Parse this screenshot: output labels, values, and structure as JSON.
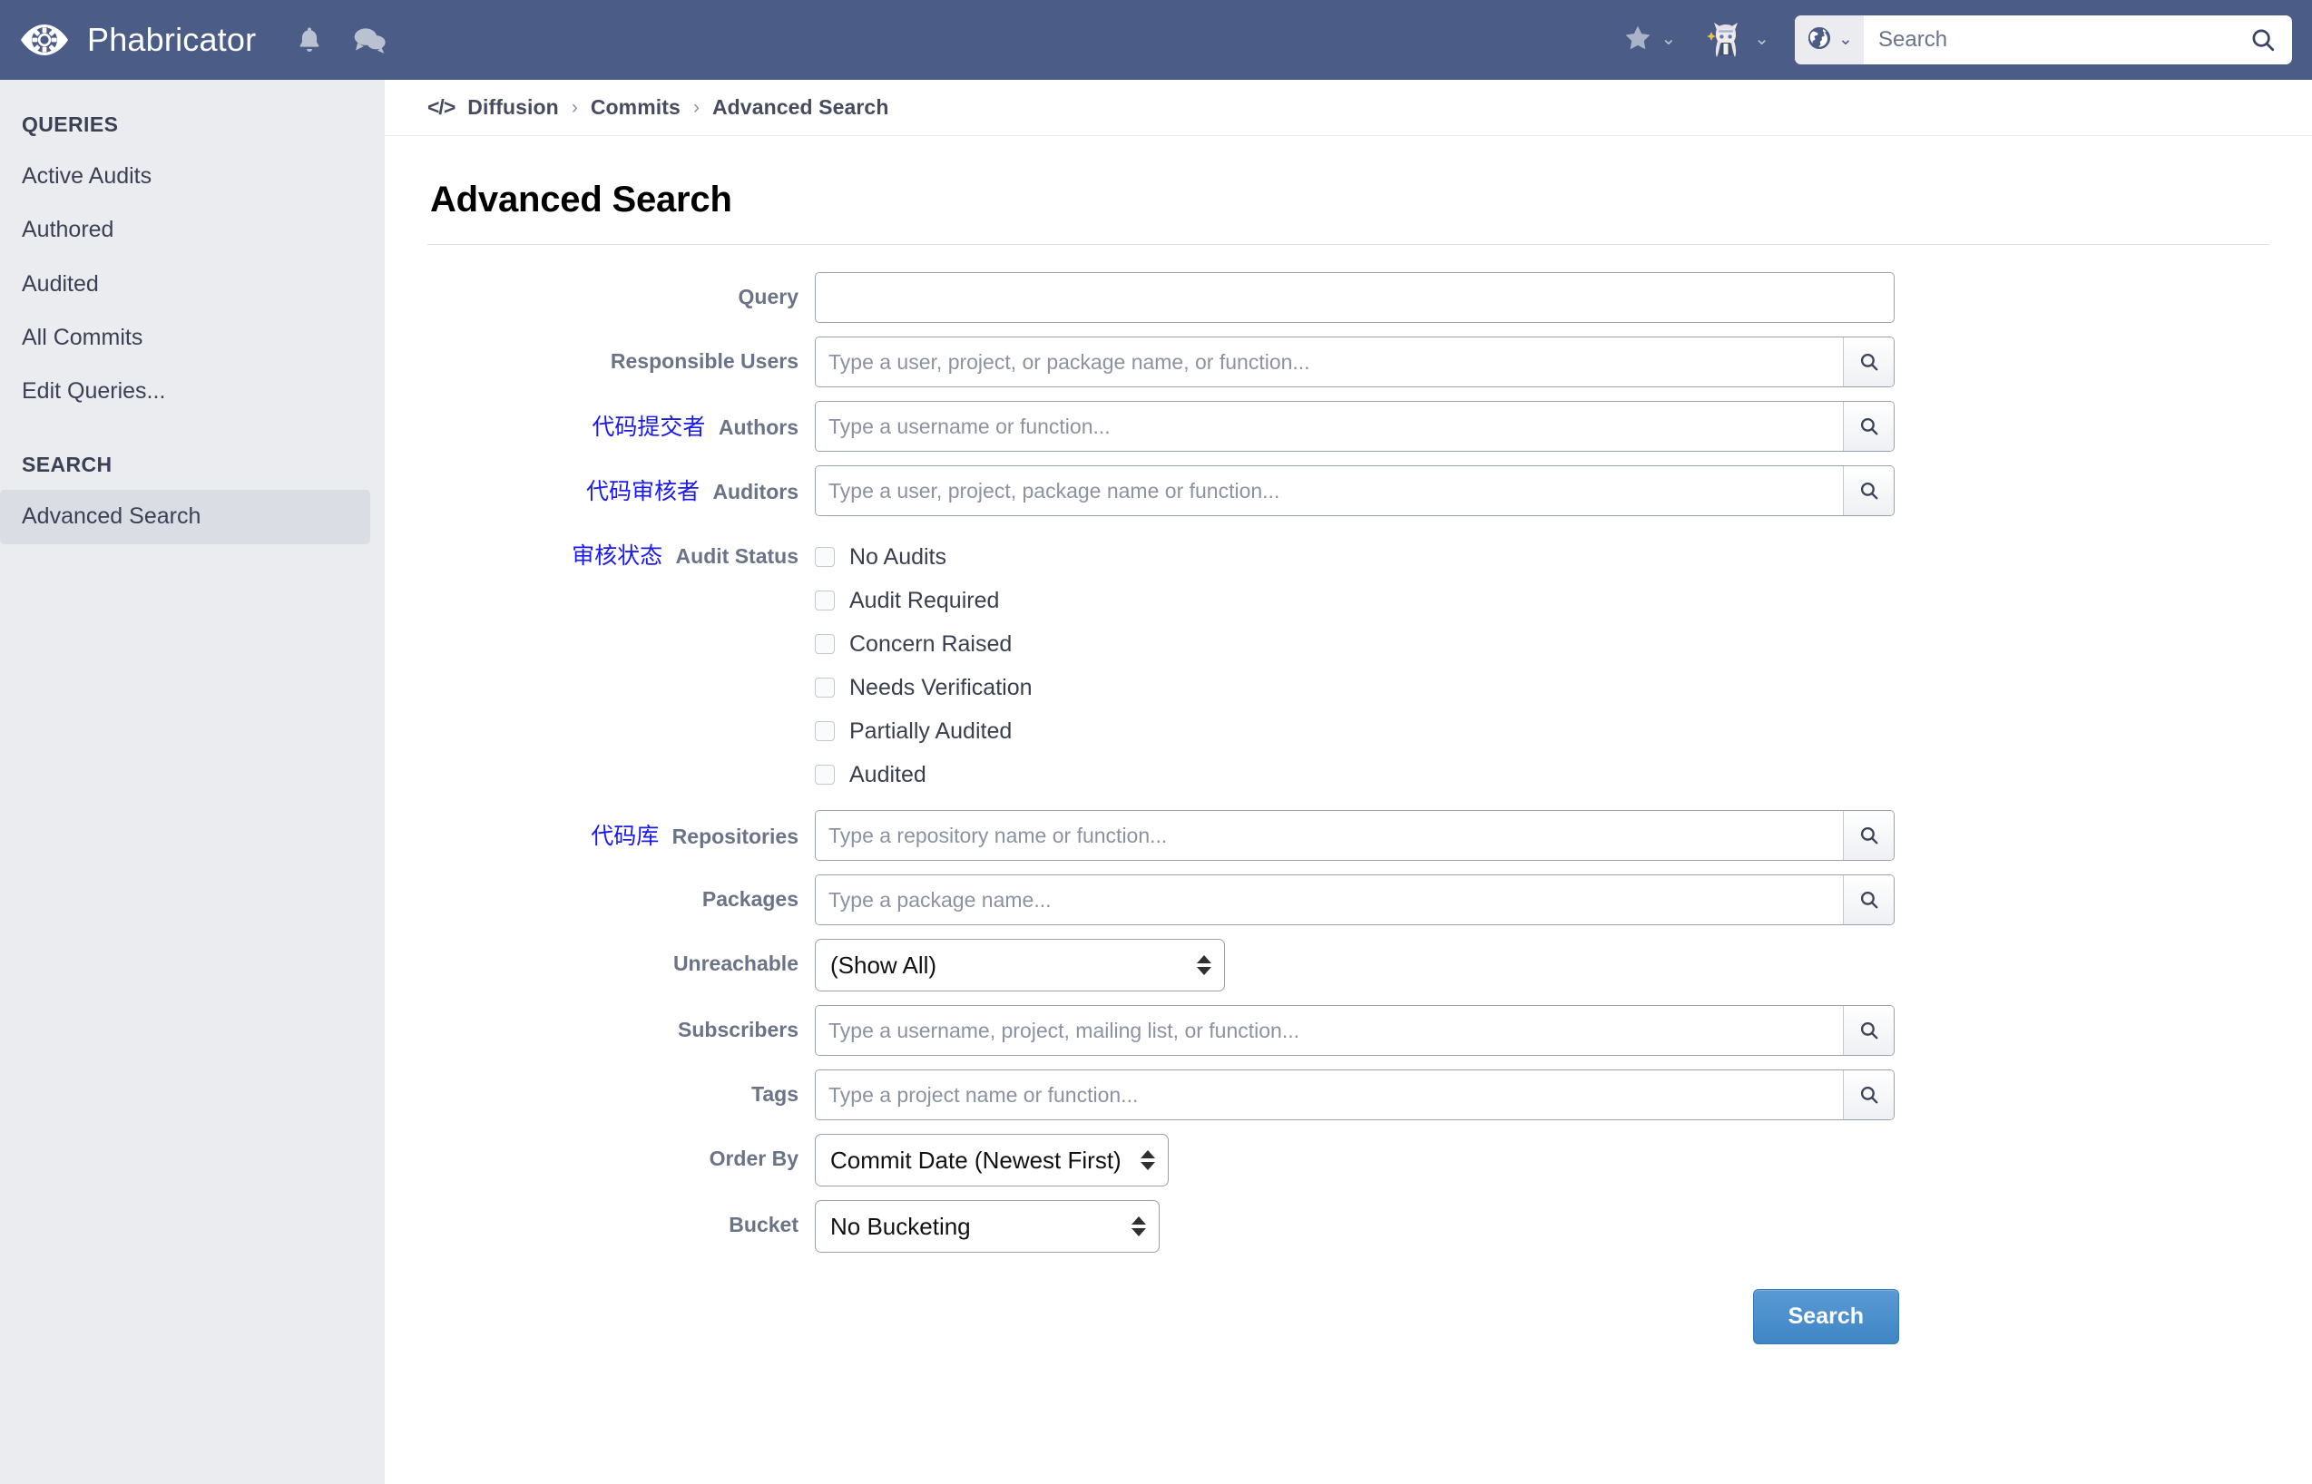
{
  "chrome": {
    "brand": "Phabricator",
    "logo_icon": "eye-gear-icon",
    "bell_icon": "bell-icon",
    "chat_icon": "chat-bubble-icon",
    "star_icon": "star-icon",
    "star_chevron_icon": "chevron-down-icon",
    "avatar_icon": "user-avatar",
    "avatar_chevron_icon": "chevron-down-icon",
    "search_scope_icon": "globe-icon",
    "search_scope_chevron_icon": "chevron-down-icon",
    "search_placeholder": "Search",
    "search_value": "",
    "search_submit_icon": "search-icon"
  },
  "sidebar": {
    "sections": [
      {
        "heading": "QUERIES",
        "items": [
          {
            "label": "Active Audits",
            "active": false
          },
          {
            "label": "Authored",
            "active": false
          },
          {
            "label": "Audited",
            "active": false
          },
          {
            "label": "All Commits",
            "active": false
          },
          {
            "label": "Edit Queries...",
            "active": false
          }
        ]
      },
      {
        "heading": "SEARCH",
        "items": [
          {
            "label": "Advanced Search",
            "active": true
          }
        ]
      }
    ]
  },
  "breadcrumb": {
    "icon": "code-icon",
    "items": [
      "Diffusion",
      "Commits",
      "Advanced Search"
    ],
    "separator": "›"
  },
  "page": {
    "title": "Advanced Search"
  },
  "form": {
    "query": {
      "label": "Query",
      "zh": "",
      "value": "",
      "placeholder": ""
    },
    "responsible_users": {
      "label": "Responsible Users",
      "zh": "",
      "value": "",
      "placeholder": "Type a user, project, or package name, or function..."
    },
    "authors": {
      "label": "Authors",
      "zh": "代码提交者",
      "value": "",
      "placeholder": "Type a username or function..."
    },
    "auditors": {
      "label": "Auditors",
      "zh": "代码审核者",
      "value": "",
      "placeholder": "Type a user, project, package name or function..."
    },
    "audit_status": {
      "label": "Audit Status",
      "zh": "审核状态",
      "options": [
        {
          "label": "No Audits",
          "checked": false
        },
        {
          "label": "Audit Required",
          "checked": false
        },
        {
          "label": "Concern Raised",
          "checked": false
        },
        {
          "label": "Needs Verification",
          "checked": false
        },
        {
          "label": "Partially Audited",
          "checked": false
        },
        {
          "label": "Audited",
          "checked": false
        }
      ]
    },
    "repositories": {
      "label": "Repositories",
      "zh": "代码库",
      "value": "",
      "placeholder": "Type a repository name or function..."
    },
    "packages": {
      "label": "Packages",
      "zh": "",
      "value": "",
      "placeholder": "Type a package name..."
    },
    "unreachable": {
      "label": "Unreachable",
      "zh": "",
      "selected": "(Show All)"
    },
    "subscribers": {
      "label": "Subscribers",
      "zh": "",
      "value": "",
      "placeholder": "Type a username, project, mailing list, or function..."
    },
    "tags": {
      "label": "Tags",
      "zh": "",
      "value": "",
      "placeholder": "Type a project name or function..."
    },
    "order_by": {
      "label": "Order By",
      "zh": "",
      "selected": "Commit Date (Newest First)"
    },
    "bucket": {
      "label": "Bucket",
      "zh": "",
      "selected": "No Bucketing"
    },
    "submit_label": "Search",
    "typeahead_icon": "search-icon"
  },
  "colors": {
    "chrome_bg": "#4b5d87",
    "sidebar_bg": "#ebecf0",
    "sidebar_active_bg": "#dadde4",
    "accent_button": "#3f86c5",
    "annotation_blue": "#1a1aee",
    "label_gray": "#6b7386"
  }
}
